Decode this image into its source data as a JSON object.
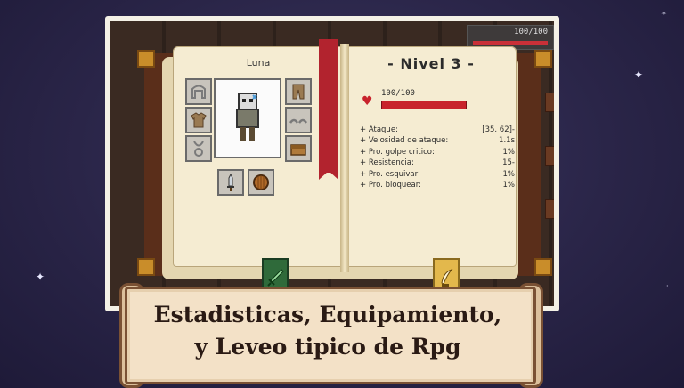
{
  "hud": {
    "hp_text": "100/100"
  },
  "character": {
    "name": "Luna",
    "equipment_slots": [
      {
        "icon": "helmet-icon"
      },
      {
        "icon": "armor-icon"
      },
      {
        "icon": "amulet-icon"
      },
      {
        "icon": "pants-icon"
      },
      {
        "icon": "boots-icon"
      },
      {
        "icon": "bag-icon"
      },
      {
        "icon": "dagger-icon"
      },
      {
        "icon": "shield-icon"
      }
    ]
  },
  "stats_page": {
    "level_label": "- Nivel 3 -",
    "hp_text": "100/100",
    "hp_fraction": 1.0,
    "stats": [
      {
        "label": "+ Ataque:",
        "value": "[35. 62]-"
      },
      {
        "label": "+ Velosidad de ataque:",
        "value": "1.1s"
      },
      {
        "label": "+ Pro. golpe critico:",
        "value": "1%"
      },
      {
        "label": "+ Resistencia:",
        "value": "15-"
      },
      {
        "label": "+ Pro. esquivar:",
        "value": "1%"
      },
      {
        "label": "+ Pro. bloquear:",
        "value": "1%"
      }
    ]
  },
  "tabs": [
    {
      "icon": "sword-icon",
      "color": "#2f6a3a"
    },
    {
      "icon": "quill-icon",
      "color": "#e3b84c"
    }
  ],
  "caption": {
    "line1": "Estadisticas, Equipamiento,",
    "line2": "y Leveo tipico de Rpg"
  },
  "colors": {
    "background": "#2a2548",
    "hp_red": "#c8232c",
    "page": "#f5ecd2"
  }
}
